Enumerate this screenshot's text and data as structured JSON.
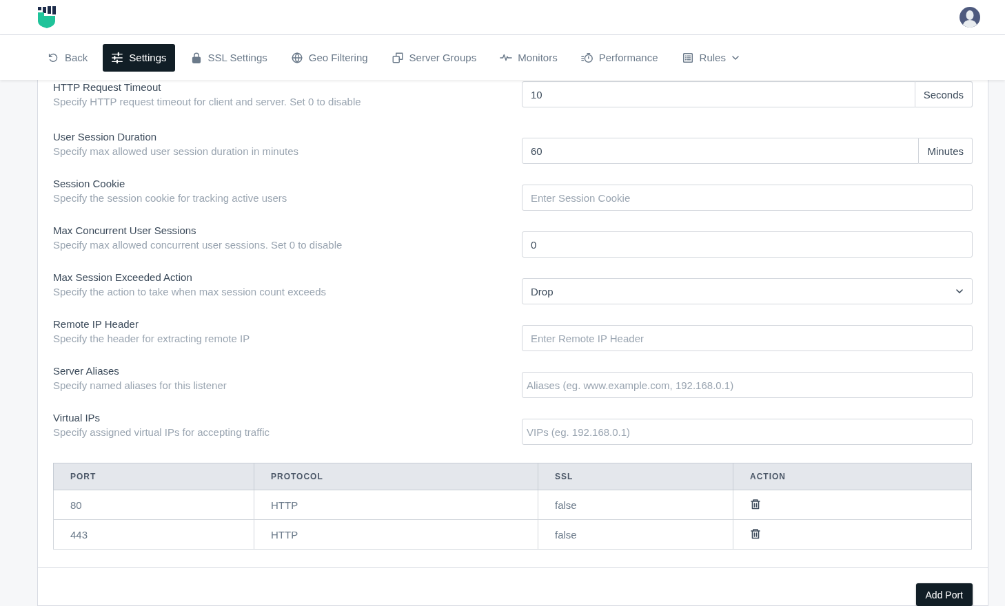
{
  "nav": {
    "tabs": [
      {
        "label": "Back",
        "selected": false
      },
      {
        "label": "Settings",
        "selected": true
      },
      {
        "label": "SSL Settings",
        "selected": false
      },
      {
        "label": "Geo Filtering",
        "selected": false
      },
      {
        "label": "Server Groups",
        "selected": false
      },
      {
        "label": "Monitors",
        "selected": false
      },
      {
        "label": "Performance",
        "selected": false
      },
      {
        "label": "Rules",
        "selected": false,
        "dropdown": true
      }
    ]
  },
  "settings": [
    {
      "label": "HTTP Request Timeout",
      "help": "Specify HTTP request timeout for client and server. Set 0 to disable",
      "kind": "addon",
      "value": "10",
      "addon": "Seconds"
    },
    {
      "label": "User Session Duration",
      "help": "Specify max allowed user session duration in minutes",
      "kind": "addon",
      "value": "60",
      "addon": "Minutes"
    },
    {
      "label": "Session Cookie",
      "help": "Specify the session cookie for tracking active users",
      "kind": "text",
      "placeholder": "Enter Session Cookie"
    },
    {
      "label": "Max Concurrent User Sessions",
      "help": "Specify max allowed concurrent user sessions. Set 0 to disable",
      "kind": "text",
      "value": "0"
    },
    {
      "label": "Max Session Exceeded Action",
      "help": "Specify the action to take when max session count exceeds",
      "kind": "select",
      "value": "Drop"
    },
    {
      "label": "Remote IP Header",
      "help": "Specify the header for extracting remote IP",
      "kind": "text",
      "placeholder": "Enter Remote IP Header"
    },
    {
      "label": "Server Aliases",
      "help": "Specify named aliases for this listener",
      "kind": "tags",
      "placeholder": "Aliases (eg. www.example.com, 192.168.0.1)"
    },
    {
      "label": "Virtual IPs",
      "help": "Specify assigned virtual IPs for accepting traffic",
      "kind": "tags",
      "placeholder": "VIPs (eg. 192.168.0.1)"
    }
  ],
  "ports_table": {
    "columns": [
      "PORT",
      "PROTOCOL",
      "SSL",
      "ACTION"
    ],
    "rows": [
      {
        "port": "80",
        "protocol": "HTTP",
        "ssl": "false"
      },
      {
        "port": "443",
        "protocol": "HTTP",
        "ssl": "false"
      }
    ]
  },
  "footer": {
    "button": "Add Port"
  }
}
